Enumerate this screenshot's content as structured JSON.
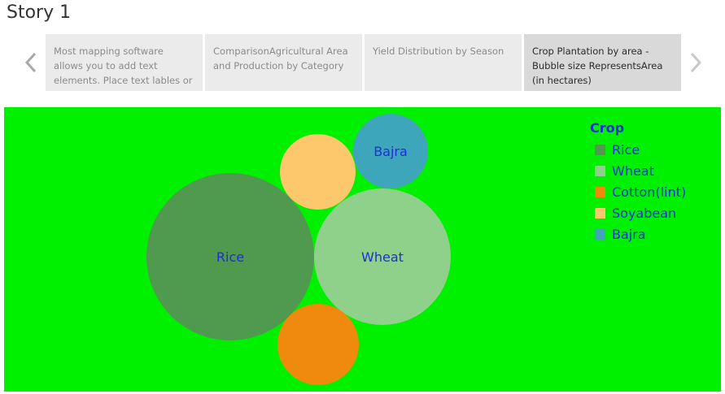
{
  "story": {
    "title": "Story 1"
  },
  "navigation": {
    "prev_icon": "chevron-left-icon",
    "next_icon": "chevron-right-icon"
  },
  "story_points": [
    {
      "label": "Most mapping software allows you to add text elements. Place text lables or",
      "active": false
    },
    {
      "label": "ComparisonAgricultural Area and Production by Category",
      "active": false
    },
    {
      "label": "Yield Distribution by Season",
      "active": false
    },
    {
      "label": "Crop Plantation by area - Bubble size RepresentsArea (in hectares)",
      "active": true
    }
  ],
  "colors": {
    "canvas_background": "#00f100",
    "label_color": "#1f2ed6"
  },
  "chart_data": {
    "type": "bubble",
    "title": "",
    "size_field": "Area (in hectares)",
    "series": [
      {
        "name": "Rice",
        "label": "Rice",
        "color": "#4f9a4f",
        "relative_area": 1.0
      },
      {
        "name": "Wheat",
        "label": "Wheat",
        "color": "#8fd18a",
        "relative_area": 0.67
      },
      {
        "name": "Cotton(lint)",
        "label": "",
        "color": "#ef8a0f",
        "relative_area": 0.24
      },
      {
        "name": "Soyabean",
        "label": "",
        "color": "#fdc76c",
        "relative_area": 0.2
      },
      {
        "name": "Bajra",
        "label": "Bajra",
        "color": "#3ea6ba",
        "relative_area": 0.2
      }
    ],
    "legend": {
      "title": "Crop",
      "position": "top-right",
      "items": [
        "Rice",
        "Wheat",
        "Cotton(lint)",
        "Soyabean",
        "Bajra"
      ]
    }
  }
}
